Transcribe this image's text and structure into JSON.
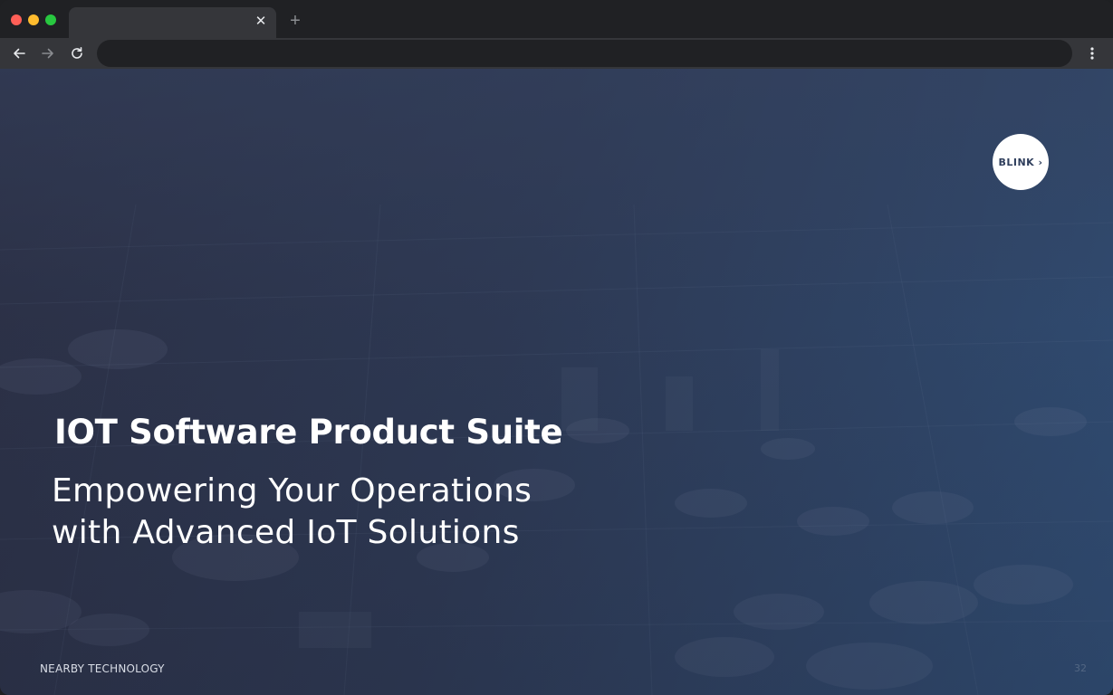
{
  "browser": {
    "tab_title": "",
    "tab_close_icon": "close-icon",
    "new_tab_symbol": "+",
    "address": "",
    "nav_icons": [
      "back-arrow-icon",
      "forward-arrow-icon",
      "reload-icon",
      "kebab-menu-icon"
    ]
  },
  "slide": {
    "logo_text": "BLINK ›",
    "title": "IOT Software Product Suite",
    "subtitle_line1": "Empowering Your Operations",
    "subtitle_line2": "with Advanced IoT Solutions",
    "footer_left": "NEARBY TECHNOLOGY",
    "page_number": "32"
  },
  "colors": {
    "chrome_dark": "#202124",
    "chrome_toolbar": "#35363a",
    "slide_left": "#2c3045",
    "slide_right": "#31517a",
    "logo_text": "#2f3e5c"
  }
}
